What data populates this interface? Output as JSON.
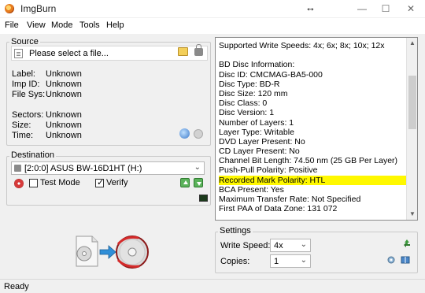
{
  "window": {
    "title": "ImgBurn",
    "move_cursor": "↔",
    "minimize": "—",
    "maximize": "☐",
    "close": "✕"
  },
  "menu": [
    "File",
    "View",
    "Mode",
    "Tools",
    "Help"
  ],
  "source": {
    "group_title": "Source",
    "placeholder": "Please select a file...",
    "info": [
      {
        "label": "Label:",
        "value": "Unknown"
      },
      {
        "label": "Imp ID:",
        "value": "Unknown"
      },
      {
        "label": "File Sys:",
        "value": "Unknown"
      }
    ],
    "stats": [
      {
        "label": "Sectors:",
        "value": "Unknown"
      },
      {
        "label": "Size:",
        "value": "Unknown"
      },
      {
        "label": "Time:",
        "value": "Unknown"
      }
    ]
  },
  "destination": {
    "group_title": "Destination",
    "drive": "[2:0:0] ASUS BW-16D1HT (H:)",
    "test_mode_label": "Test Mode",
    "test_mode_checked": false,
    "verify_label": "Verify",
    "verify_checked": true
  },
  "log": {
    "lines": [
      "Supported Write Speeds: 4x; 6x; 8x; 10x; 12x",
      "",
      "BD Disc Information:",
      "Disc ID: CMCMAG-BA5-000",
      "Disc Type: BD-R",
      "Disc Size: 120 mm",
      "Disc Class: 0",
      "Disc Version: 1",
      "Number of Layers: 1",
      "Layer Type: Writable",
      "DVD Layer Present: No",
      "CD Layer Present: No",
      "Channel Bit Length: 74.50 nm (25 GB Per Layer)",
      "Push-Pull Polarity: Positive",
      "Recorded Mark Polarity: HTL",
      "BCA Present: Yes",
      "Maximum Transfer Rate: Not Specified",
      "First PAA of Data Zone: 131 072"
    ],
    "highlight_index": 14,
    "highlight_color": "#fff800"
  },
  "settings": {
    "group_title": "Settings",
    "write_speed_label": "Write Speed:",
    "write_speed_value": "4x",
    "copies_label": "Copies:",
    "copies_value": "1"
  },
  "status": {
    "text": "Ready"
  }
}
